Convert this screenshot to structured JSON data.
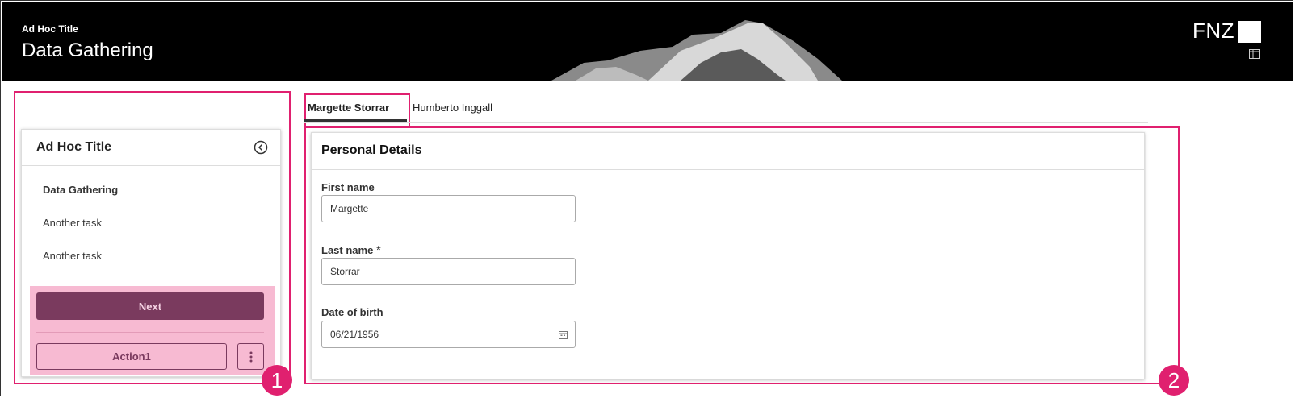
{
  "header": {
    "small_title": "Ad Hoc Title",
    "title": "Data Gathering",
    "brand": "FNZ",
    "layout_icon": "layout-toggle-icon"
  },
  "sidebar": {
    "card_title": "Ad Hoc Title",
    "collapse_icon": "chevron-left-circle-icon",
    "tasks": [
      {
        "label": "Data Gathering",
        "active": true
      },
      {
        "label": "Another task",
        "active": false
      },
      {
        "label": "Another task",
        "active": false
      }
    ],
    "next_label": "Next",
    "action_label": "Action1",
    "more_icon": "more-vertical-icon"
  },
  "tabs": [
    {
      "label": "Margette Storrar",
      "active": true
    },
    {
      "label": "Humberto Inggall",
      "active": false
    }
  ],
  "form": {
    "section_title": "Personal Details",
    "first_name": {
      "label": "First name",
      "value": "Margette"
    },
    "last_name": {
      "label": "Last name",
      "required": "*",
      "value": "Storrar"
    },
    "dob": {
      "label": "Date of birth",
      "value": "06/21/1956",
      "icon": "calendar-icon"
    }
  },
  "annotations": {
    "badge1": "1",
    "badge2": "2",
    "color": "#e0206f"
  },
  "colors": {
    "primary": "#7a3a5e",
    "action_zone": "#f7bad2",
    "header_bg": "#000000"
  }
}
